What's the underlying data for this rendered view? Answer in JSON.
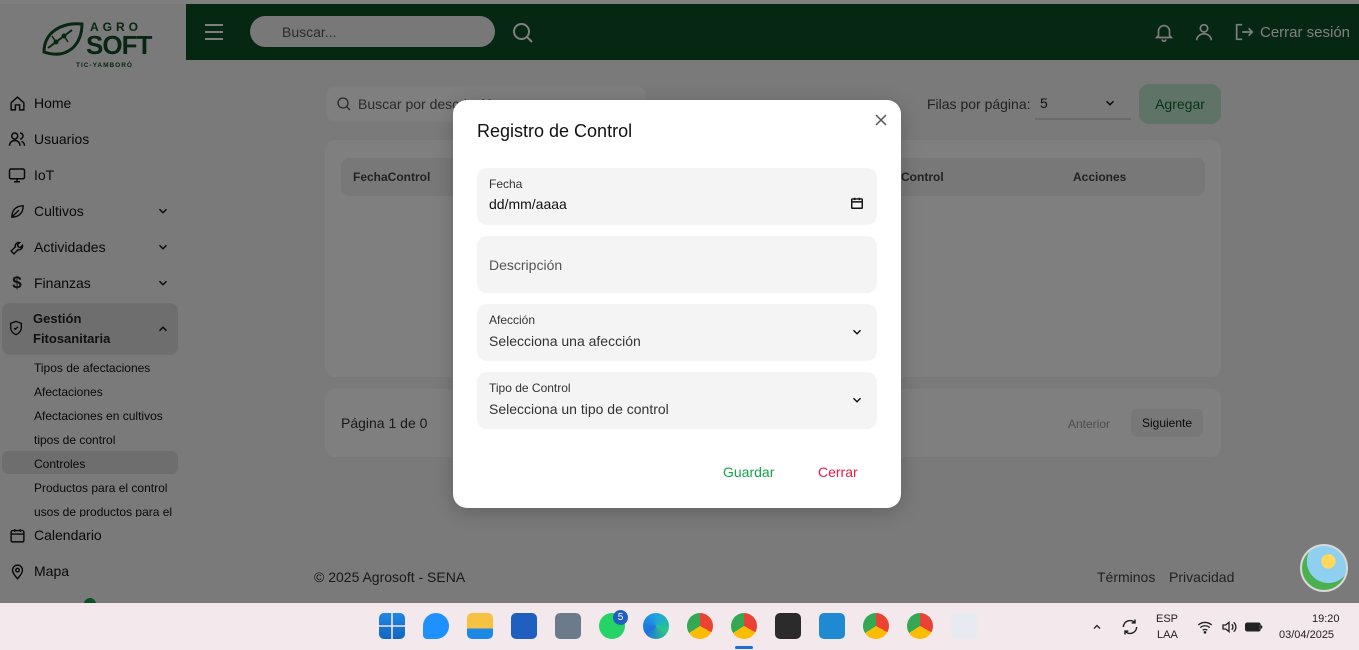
{
  "brand": {
    "top": "AGRO",
    "main": "SOFT",
    "sub": "TIC-YAMBORÓ"
  },
  "sidebar": {
    "items": [
      {
        "label": "Home",
        "icon": "home-icon"
      },
      {
        "label": "Usuarios",
        "icon": "users-icon"
      },
      {
        "label": "IoT",
        "icon": "monitor-icon"
      },
      {
        "label": "Cultivos",
        "icon": "leaf-icon"
      },
      {
        "label": "Actividades",
        "icon": "wrench-icon"
      },
      {
        "label": "Finanzas",
        "icon": "dollar-icon"
      }
    ],
    "group": {
      "label_line1": "Gestión",
      "label_line2": "Fitosanitaria",
      "icon": "shield-icon"
    },
    "subitems": [
      "Tipos de afectaciones",
      "Afectaciones",
      "Afectaciones en cultivos",
      "tipos de control",
      "Controles",
      "Productos para el control",
      "usos de productos para el"
    ],
    "bottom": [
      {
        "label": "Calendario",
        "icon": "calendar-icon"
      },
      {
        "label": "Mapa",
        "icon": "map-pin-icon"
      }
    ]
  },
  "header": {
    "search_placeholder": "Buscar...",
    "logout_label": "Cerrar sesión"
  },
  "toolbar": {
    "search_placeholder": "Buscar por descripción",
    "rows_label": "Filas por página:",
    "rows_value": "5",
    "add_label": "Agregar"
  },
  "table": {
    "columns": [
      "FechaControl",
      "Control",
      "Acciones"
    ]
  },
  "pagination": {
    "info": "Página 1 de 0",
    "prev": "Anterior",
    "next": "Siguiente"
  },
  "footer": {
    "copyright": "© 2025 Agrosoft - SENA",
    "terms": "Términos",
    "privacy": "Privacidad"
  },
  "modal": {
    "title": "Registro de Control",
    "fecha_label": "Fecha",
    "fecha_value": "dd/mm/aaaa",
    "descripcion_placeholder": "Descripción",
    "afeccion_label": "Afección",
    "afeccion_value": "Selecciona una afección",
    "tipo_label": "Tipo de Control",
    "tipo_value": "Selecciona un tipo de control",
    "save": "Guardar",
    "close": "Cerrar"
  },
  "taskbar": {
    "whatsapp_badge": "5",
    "lang_top": "ESP",
    "lang_bottom": "LAA",
    "time": "19:20",
    "date": "03/04/2025"
  },
  "colors": {
    "header": "#0c5025",
    "accent_green": "#17a34a",
    "accent_red": "#e11d48"
  }
}
